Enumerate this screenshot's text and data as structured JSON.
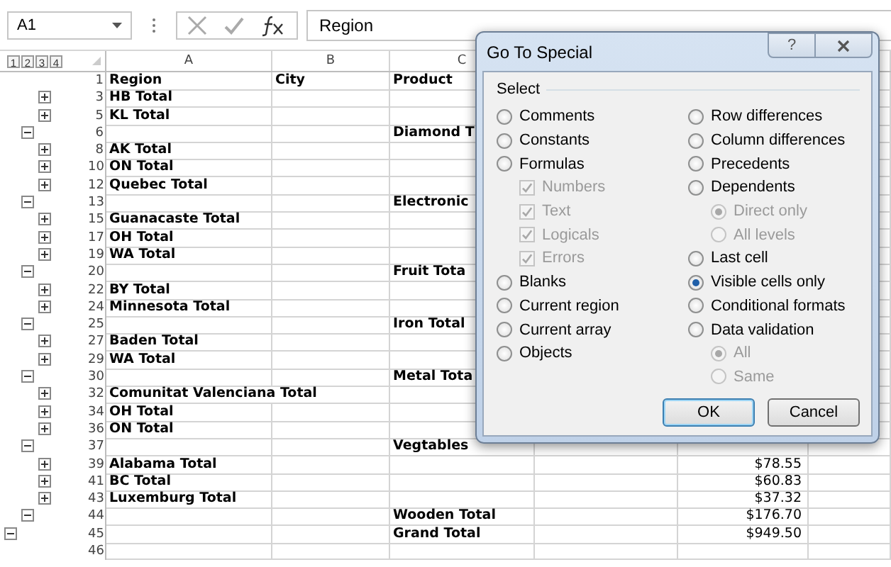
{
  "formula_bar": {
    "name_box": "A1",
    "formula": "Region"
  },
  "outline_levels": [
    "1",
    "2",
    "3",
    "4"
  ],
  "columns": [
    "A",
    "B",
    "C"
  ],
  "rows": [
    {
      "number": "1",
      "a": "Region",
      "b": "City",
      "c": "Product"
    },
    {
      "number": "3",
      "a": "HB Total",
      "outline_button": {
        "kind": "expand"
      }
    },
    {
      "number": "5",
      "a": "KL Total",
      "outline_button": {
        "kind": "expand"
      }
    },
    {
      "number": "6",
      "c": "Diamond T",
      "outline_button": {
        "kind": "collapse"
      }
    },
    {
      "number": "8",
      "a": "AK Total",
      "outline_button": {
        "kind": "expand"
      }
    },
    {
      "number": "10",
      "a": "ON Total",
      "outline_button": {
        "kind": "expand"
      }
    },
    {
      "number": "12",
      "a": "Quebec Total",
      "outline_button": {
        "kind": "expand"
      }
    },
    {
      "number": "13",
      "c": "Electronic",
      "outline_button": {
        "kind": "collapse"
      }
    },
    {
      "number": "15",
      "a": "Guanacaste Total",
      "outline_button": {
        "kind": "expand"
      }
    },
    {
      "number": "17",
      "a": "OH Total",
      "outline_button": {
        "kind": "expand"
      }
    },
    {
      "number": "19",
      "a": "WA Total",
      "outline_button": {
        "kind": "expand"
      }
    },
    {
      "number": "20",
      "c": "Fruit Tota",
      "outline_button": {
        "kind": "collapse"
      }
    },
    {
      "number": "22",
      "a": "BY Total",
      "outline_button": {
        "kind": "expand"
      }
    },
    {
      "number": "24",
      "a": "Minnesota Total",
      "outline_button": {
        "kind": "expand"
      }
    },
    {
      "number": "25",
      "c": "Iron Total",
      "outline_button": {
        "kind": "collapse"
      }
    },
    {
      "number": "27",
      "a": "Baden Total",
      "outline_button": {
        "kind": "expand"
      }
    },
    {
      "number": "29",
      "a": "WA Total",
      "outline_button": {
        "kind": "expand"
      }
    },
    {
      "number": "30",
      "c": "Metal Tota",
      "outline_button": {
        "kind": "collapse"
      }
    },
    {
      "number": "32",
      "a": "Comunitat Valenciana Total",
      "outline_button": {
        "kind": "expand"
      }
    },
    {
      "number": "34",
      "a": "OH Total",
      "outline_button": {
        "kind": "expand"
      }
    },
    {
      "number": "36",
      "a": "ON Total",
      "outline_button": {
        "kind": "expand"
      }
    },
    {
      "number": "37",
      "c": "Vegtables",
      "outline_button": {
        "kind": "collapse"
      }
    },
    {
      "number": "39",
      "a": "Alabama Total",
      "e": "$78.55",
      "outline_button": {
        "kind": "expand"
      }
    },
    {
      "number": "41",
      "a": "BC Total",
      "e": "$60.83",
      "outline_button": {
        "kind": "expand"
      }
    },
    {
      "number": "43",
      "a": "Luxemburg Total",
      "e": "$37.32",
      "outline_button": {
        "kind": "expand"
      }
    },
    {
      "number": "44",
      "c": "Wooden Total",
      "e": "$176.70",
      "outline_button": {
        "kind": "collapse"
      }
    },
    {
      "number": "45",
      "c": "Grand Total",
      "e": "$949.50",
      "outline_button": {
        "kind": "collapse_top"
      }
    },
    {
      "number": "46"
    }
  ],
  "dialog": {
    "title": "Go To Special",
    "help": "?",
    "group": "Select",
    "left": [
      {
        "kind": "radio",
        "label": "Comments",
        "selected": false,
        "disabled": false
      },
      {
        "kind": "radio",
        "label": "Constants",
        "selected": false,
        "disabled": false
      },
      {
        "kind": "radio",
        "label": "Formulas",
        "selected": false,
        "disabled": false,
        "children": [
          {
            "kind": "checkbox",
            "label": "Numbers",
            "checked": true,
            "disabled": true
          },
          {
            "kind": "checkbox",
            "label": "Text",
            "checked": true,
            "disabled": true
          },
          {
            "kind": "checkbox",
            "label": "Logicals",
            "checked": true,
            "disabled": true
          },
          {
            "kind": "checkbox",
            "label": "Errors",
            "checked": true,
            "disabled": true
          }
        ]
      },
      {
        "kind": "radio",
        "label": "Blanks",
        "selected": false,
        "disabled": false
      },
      {
        "kind": "radio",
        "label": "Current region",
        "selected": false,
        "disabled": false
      },
      {
        "kind": "radio",
        "label": "Current array",
        "selected": false,
        "disabled": false
      },
      {
        "kind": "radio",
        "label": "Objects",
        "selected": false,
        "disabled": false
      }
    ],
    "right": [
      {
        "kind": "radio",
        "label": "Row differences",
        "selected": false,
        "disabled": false
      },
      {
        "kind": "radio",
        "label": "Column differences",
        "selected": false,
        "disabled": false
      },
      {
        "kind": "radio",
        "label": "Precedents",
        "selected": false,
        "disabled": false
      },
      {
        "kind": "radio",
        "label": "Dependents",
        "selected": false,
        "disabled": false,
        "children": [
          {
            "kind": "radio",
            "label": "Direct only",
            "selected": true,
            "disabled": true
          },
          {
            "kind": "radio",
            "label": "All levels",
            "selected": false,
            "disabled": true
          }
        ]
      },
      {
        "kind": "radio",
        "label": "Last cell",
        "selected": false,
        "disabled": false
      },
      {
        "kind": "radio",
        "label": "Visible cells only",
        "selected": true,
        "disabled": false
      },
      {
        "kind": "radio",
        "label": "Conditional formats",
        "selected": false,
        "disabled": false
      },
      {
        "kind": "radio",
        "label": "Data validation",
        "selected": false,
        "disabled": false,
        "children": [
          {
            "kind": "radio",
            "label": "All",
            "selected": true,
            "disabled": true
          },
          {
            "kind": "radio",
            "label": "Same",
            "selected": false,
            "disabled": true
          }
        ]
      }
    ],
    "buttons": [
      {
        "label": "OK",
        "default": true
      },
      {
        "label": "Cancel",
        "default": false
      }
    ]
  }
}
